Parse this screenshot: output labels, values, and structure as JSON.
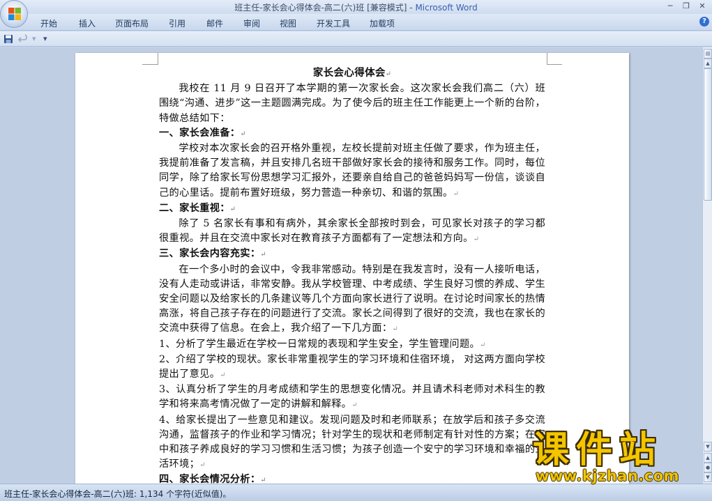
{
  "window": {
    "title_doc": "班主任-家长会心得体会-高二(六)班 [兼容模式]",
    "title_sep": " - ",
    "title_app": "Microsoft Word",
    "min_icon": "minimize-icon",
    "max_icon": "maximize-icon",
    "close_icon": "close-icon"
  },
  "ribbon": {
    "tabs": [
      "开始",
      "插入",
      "页面布局",
      "引用",
      "邮件",
      "审阅",
      "视图",
      "开发工具",
      "加载项"
    ],
    "help": "?"
  },
  "quick_access": {
    "save_icon": "save-icon",
    "undo_icon": "undo-icon",
    "customize_icon": "dropdown-icon"
  },
  "document": {
    "title": "家长会心得体会",
    "intro": "我校在 11 月 9 日召开了本学期的第一次家长会。这次家长会我们高二（六）班围绕“沟通、进步”这一主题圆满完成。为了使今后的班主任工作能更上一个新的台阶，特做总结如下：",
    "h1": "一、家长会准备：",
    "p1": "学校对本次家长会的召开格外重视，左校长提前对班主任做了要求，作为班主任，我提前准备了发言稿，并且安排几名班干部做好家长会的接待和服务工作。同时，每位同学，除了给家长写份思想学习汇报外，还要亲自给自己的爸爸妈妈写一份信，谈谈自己的心里话。提前布置好班级，努力营造一种亲切、和谐的氛围。",
    "h2": "二、家长重视：",
    "p2": "除了 5 名家长有事和有病外，其余家长全部按时到会，可见家长对孩子的学习都很重视。并且在交流中家长对在教育孩子方面都有了一定想法和方向。",
    "h3": "三、家长会内容充实：",
    "p3": "在一个多小时的会议中，令我非常感动。特别是在我发言时，没有一人接听电话，没有人走动或讲话，非常安静。我从学校管理、中考成绩、学生良好习惯的养成、学生安全问题以及给家长的几条建议等几个方面向家长进行了说明。在讨论时间家长的热情高涨，将自己孩子存在的问题进行了交流。家长之间得到了很好的交流，我也在家长的交流中获得了信息。在会上，我介绍了一下几方面：",
    "i1": "1、分析了学生最近在学校一日常规的表现和学生安全，学生管理问题。",
    "i2": "2、介绍了学校的现状。家长非常重视学生的学习环境和住宿环境，  对这两方面向学校提出了意见。",
    "i3": "3、认真分析了学生的月考成绩和学生的思想变化情况。并且请术科老师对术科生的教学和将来高考情况做了一定的讲解和解释。",
    "i4": "4、给家长提出了一些意见和建议。发现问题及时和老师联系；在放学后和孩子多交流沟通，监督孩子的作业和学习情况；针对学生的现状和老师制定有针对性的方案；在家中和孩子养成良好的学习习惯和生活习惯；为孩子创造一个安宁的学习环境和幸福的生活环境；",
    "h4": "四、家长会情况分析：",
    "para_mark": "↵"
  },
  "status": {
    "text": "班主任-家长会心得体会-高二(六)班: 1,134 个字符(近似值)。"
  },
  "watermark": {
    "main": "课件站",
    "url": "www.kjzhan.com"
  },
  "colors": {
    "title_app": "#3a5fb0",
    "watermark": "#f2c500",
    "ribbon_bg": "#cfdcef"
  }
}
